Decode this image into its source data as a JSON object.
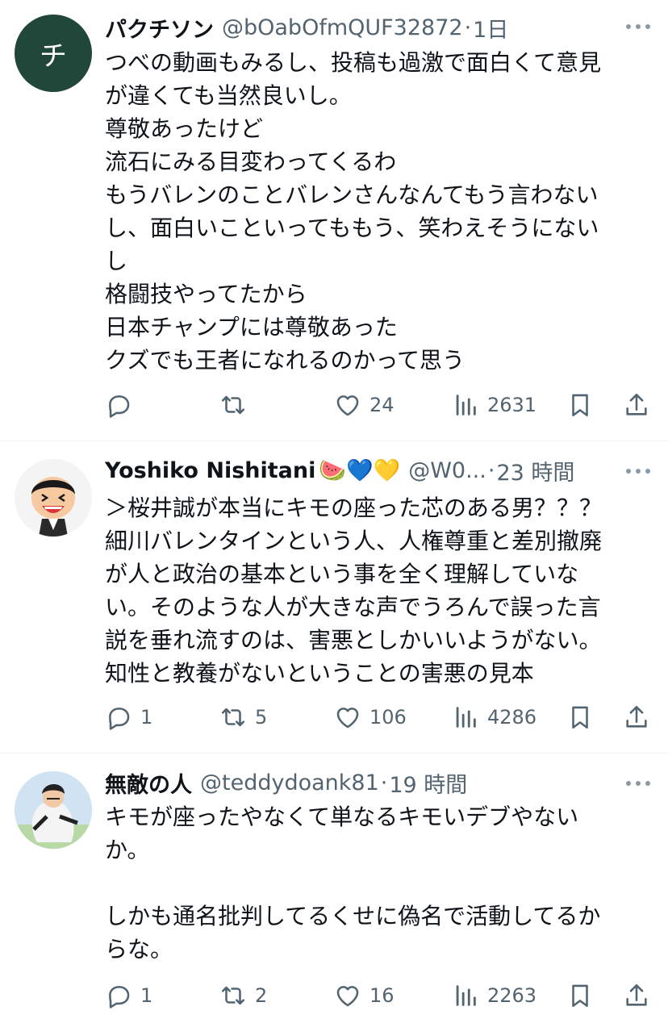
{
  "posts": [
    {
      "avatar_letter": "チ",
      "avatar_color": "#21473a",
      "name": "パクチソン",
      "emoji": "",
      "handle": "@bOabOfmQUF32872",
      "separator": "·",
      "time": "1日",
      "text": "つべの動画もみるし、投稿も過激で面白くて意見\nが違くても当然良いし。\n尊敬あったけど\n流石にみる目変わってくるわ\nもうバレンのことバレンさんなんてもう言わない\nし、面白いこといってももう、笑わえそうにない\nし\n格闘技やってたから\n日本チャンプには尊敬あった\nクズでも王者になれるのかって思う",
      "replies": "",
      "reposts": "",
      "likes": "24",
      "views": "2631"
    },
    {
      "avatar_letter": "",
      "avatar_color": "#f2f2f2",
      "name": "Yoshiko Nishitani",
      "emoji": "🍉💙💛",
      "handle": "@W0...",
      "separator": "·",
      "time": "23 時間",
      "text": "＞桜井誠が本当にキモの座った芯のある男？？？\n細川バレンタインという人、人権尊重と差別撤廃\nが人と政治の基本という事を全く理解していな\nい。そのような人が大きな声でうろんで誤った言\n説を垂れ流すのは、害悪としかいいようがない。\n知性と教養がないということの害悪の見本",
      "replies": "1",
      "reposts": "5",
      "likes": "106",
      "views": "4286"
    },
    {
      "avatar_letter": "",
      "avatar_color": "#cfe3f2",
      "name": "無敵の人",
      "emoji": "",
      "handle": "@teddydoank81",
      "separator": "·",
      "time": "19 時間",
      "text": "キモが座ったやなくて単なるキモいデブやない\nか。\n\nしかも通名批判してるくせに偽名で活動してるか\nらな。",
      "replies": "1",
      "reposts": "2",
      "likes": "16",
      "views": "2263"
    }
  ],
  "colors": {
    "text": "#0f1419",
    "muted": "#536471",
    "divider": "#eff3f4"
  },
  "icons": [
    "reply-icon",
    "repost-icon",
    "like-icon",
    "views-icon",
    "bookmark-icon",
    "share-icon",
    "more-icon"
  ]
}
